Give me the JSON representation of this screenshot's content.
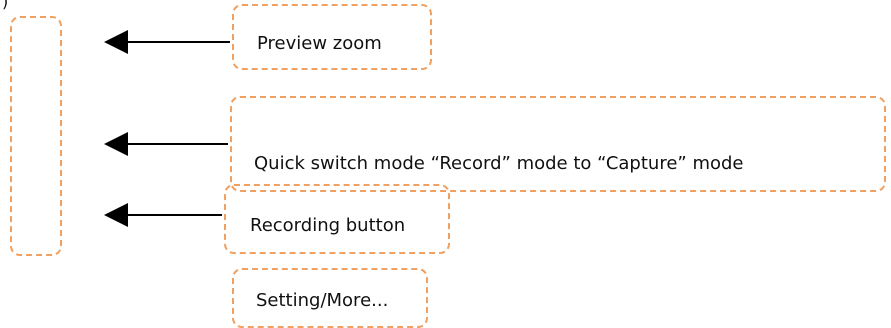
{
  "colors": {
    "accent": "#f0a060",
    "arrow": "#000000",
    "text": "#111111"
  },
  "corner_mark": ")",
  "annotations": [
    {
      "id": "preview-zoom",
      "text": "Preview zoom"
    },
    {
      "id": "quick-switch-mode",
      "text": "Quick switch mode “Record” mode to “Capture” mode"
    },
    {
      "id": "recording-button",
      "text": "Recording button"
    },
    {
      "id": "settings-more",
      "text": "Setting/More..."
    }
  ]
}
